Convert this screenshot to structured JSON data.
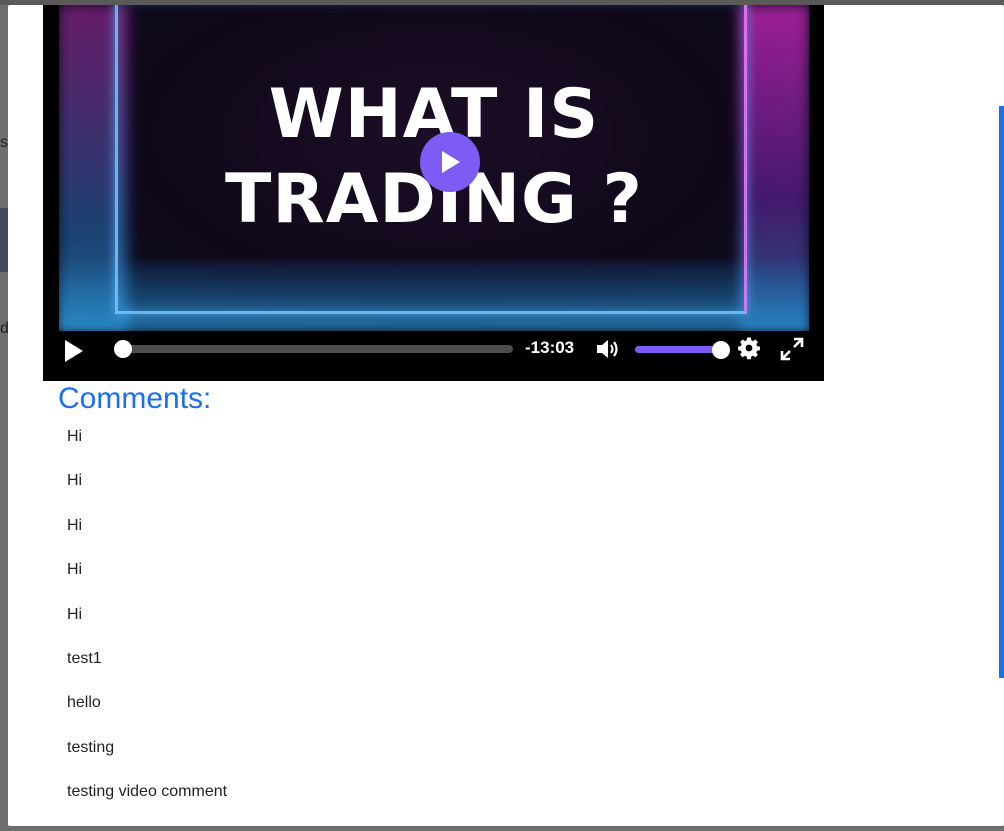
{
  "video": {
    "title_line1": "WHAT IS",
    "title_line2": "TRADING ?",
    "time_remaining": "-13:03",
    "progress": 0.02,
    "volume": 1.0,
    "accent_color": "#7c5cf5",
    "icons": {
      "big_play": "play-icon",
      "play": "play-icon",
      "volume": "volume-icon",
      "settings": "gear-icon",
      "fullscreen": "fullscreen-icon"
    }
  },
  "comments": {
    "heading": "Comments:",
    "heading_color": "#1a6ff0",
    "items": [
      "Hi",
      "Hi",
      "Hi",
      "Hi",
      "Hi",
      "test1",
      "hello",
      "testing",
      "testing video comment"
    ]
  },
  "background": {
    "char1": "s",
    "char2": "di"
  }
}
